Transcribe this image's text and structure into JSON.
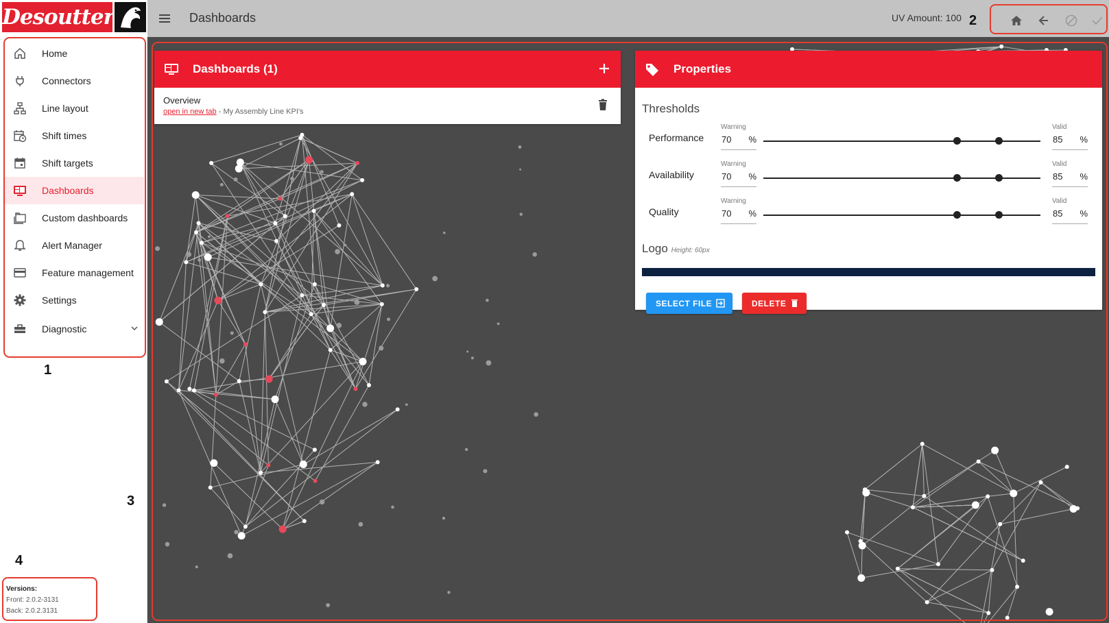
{
  "brand": {
    "logo_text": "Desoutter",
    "primary": "#ec1c2e",
    "blue": "#2196f3"
  },
  "header": {
    "title": "Dashboards",
    "uv_label": "UV Amount: 100",
    "actions": [
      "home-icon",
      "arrow-back-icon",
      "cancel-icon",
      "check-icon"
    ]
  },
  "sidebar": {
    "items": [
      {
        "label": "Home",
        "icon": "home-icon"
      },
      {
        "label": "Connectors",
        "icon": "plug-icon"
      },
      {
        "label": "Line layout",
        "icon": "sitemap-icon"
      },
      {
        "label": "Shift times",
        "icon": "calendar-clock-icon"
      },
      {
        "label": "Shift targets",
        "icon": "calendar-icon"
      },
      {
        "label": "Dashboards",
        "icon": "monitor-dashboard-icon",
        "active": true
      },
      {
        "label": "Custom dashboards",
        "icon": "folders-icon"
      },
      {
        "label": "Alert Manager",
        "icon": "bell-icon"
      },
      {
        "label": "Feature management",
        "icon": "credit-card-icon"
      },
      {
        "label": "Settings",
        "icon": "gear-icon"
      },
      {
        "label": "Diagnostic",
        "icon": "toolbox-icon",
        "expandable": true
      }
    ],
    "versions": {
      "title": "Versions:",
      "front": "Front: 2.0.2-3131",
      "back": "Back: 2.0.2.3131"
    }
  },
  "annotations": [
    "1",
    "2",
    "3",
    "4"
  ],
  "dashboards": {
    "title": "Dashboards (1)",
    "items": [
      {
        "name": "Overview",
        "link": "open in new tab",
        "description": "- My Assembly Line KPI's"
      }
    ]
  },
  "properties": {
    "title": "Properties",
    "thresholds_title": "Thresholds",
    "warning_label": "Warning",
    "valid_label": "Valid",
    "unit": "%",
    "rows": [
      {
        "label": "Performance",
        "warning": "70",
        "valid": "85"
      },
      {
        "label": "Availability",
        "warning": "70",
        "valid": "85"
      },
      {
        "label": "Quality",
        "warning": "70",
        "valid": "85"
      }
    ],
    "logo_title": "Logo",
    "logo_hint": "Height: 60px",
    "logo_color": "#0d2140",
    "select_file": "SELECT FILE",
    "delete": "DELETE"
  }
}
